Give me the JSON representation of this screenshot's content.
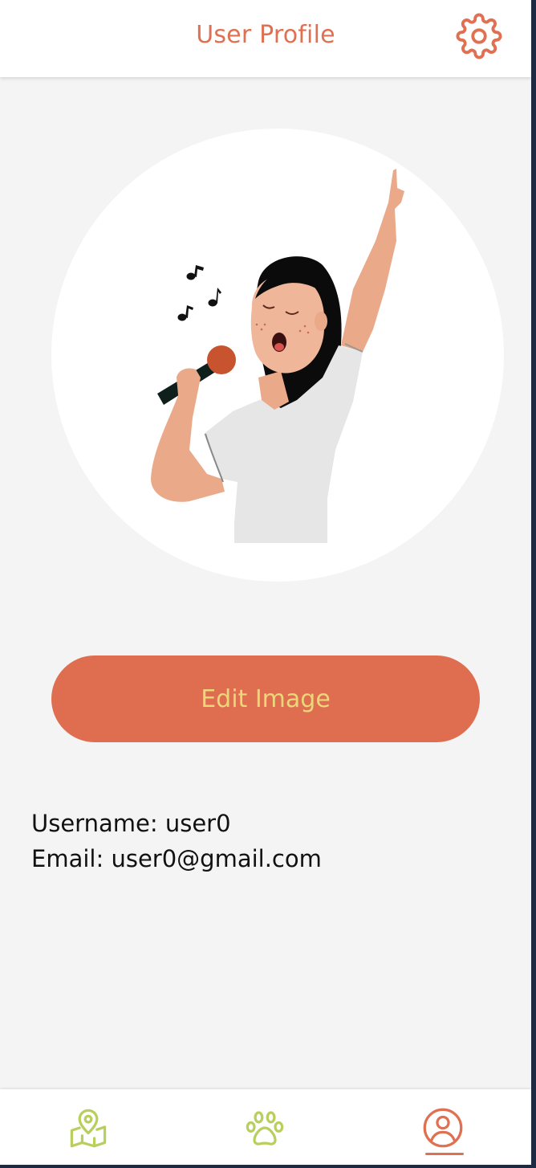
{
  "header": {
    "title": "User Profile",
    "settings_icon": "gear-icon"
  },
  "avatar": {
    "illustration": "woman-singing-into-microphone"
  },
  "edit_button": {
    "label": "Edit Image"
  },
  "profile": {
    "username_label": "Username:",
    "username_value": "user0",
    "email_label": "Email:",
    "email_value": "user0@gmail.com"
  },
  "bottom_nav": {
    "items": [
      {
        "icon": "map-pin-icon",
        "active": false
      },
      {
        "icon": "paw-icon",
        "active": false
      },
      {
        "icon": "user-profile-icon",
        "active": true
      }
    ]
  },
  "colors": {
    "accent": "#e07052",
    "button_bg": "#df6e51",
    "button_text": "#e9d77a",
    "nav_inactive": "#b8cf5e",
    "background": "#f4f4f4"
  }
}
